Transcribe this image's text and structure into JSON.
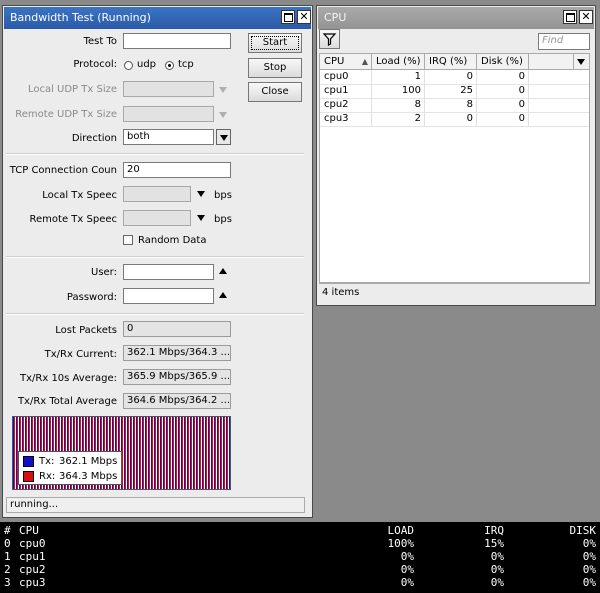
{
  "bandwidth": {
    "title": "Bandwidth Test (Running)",
    "buttons": {
      "start": "Start",
      "stop": "Stop",
      "close": "Close"
    },
    "labels": {
      "test_to": "Test To",
      "protocol": "Protocol:",
      "local_udp": "Local UDP Tx Size",
      "remote_udp": "Remote UDP Tx Size",
      "direction": "Direction",
      "tcp_conn": "TCP Connection Coun",
      "local_tx": "Local Tx Speec",
      "remote_tx": "Remote Tx Speec",
      "user": "User:",
      "password": "Password:",
      "lost": "Lost Packets",
      "current": "Tx/Rx Current:",
      "avg10": "Tx/Rx 10s Average:",
      "total": "Tx/Rx Total Average"
    },
    "protocol_udp": "udp",
    "protocol_tcp": "tcp",
    "direction_value": "both",
    "tcp_conn_value": "20",
    "bps": "bps",
    "random_data": "Random Data",
    "lost_value": "0",
    "current_value": "362.1 Mbps/364.3 ...",
    "avg10_value": "365.9 Mbps/365.9 ...",
    "total_value": "364.6 Mbps/364.2 ...",
    "legend_tx_label": "Tx:",
    "legend_tx_value": "362.1 Mbps",
    "legend_rx_label": "Rx:",
    "legend_rx_value": "364.3 Mbps",
    "tx_color": "#1010c8",
    "rx_color": "#d81010",
    "status": "running..."
  },
  "cpu": {
    "title": "CPU",
    "find_placeholder": "Find",
    "columns": [
      "CPU",
      "Load (%)",
      "IRQ (%)",
      "Disk (%)"
    ],
    "rows": [
      {
        "cpu": "cpu0",
        "load": "1",
        "irq": "0",
        "disk": "0"
      },
      {
        "cpu": "cpu1",
        "load": "100",
        "irq": "25",
        "disk": "0"
      },
      {
        "cpu": "cpu2",
        "load": "8",
        "irq": "8",
        "disk": "0"
      },
      {
        "cpu": "cpu3",
        "load": "2",
        "irq": "0",
        "disk": "0"
      }
    ],
    "count": "4 items"
  },
  "terminal": {
    "header": {
      "num": "#",
      "cpu": "CPU",
      "load": "LOAD",
      "irq": "IRQ",
      "disk": "DISK"
    },
    "rows": [
      {
        "num": "0",
        "cpu": "cpu0",
        "load": "100%",
        "irq": "15%",
        "disk": "0%"
      },
      {
        "num": "1",
        "cpu": "cpu1",
        "load": "0%",
        "irq": "0%",
        "disk": "0%"
      },
      {
        "num": "2",
        "cpu": "cpu2",
        "load": "0%",
        "irq": "0%",
        "disk": "0%"
      },
      {
        "num": "3",
        "cpu": "cpu3",
        "load": "0%",
        "irq": "0%",
        "disk": "0%"
      }
    ]
  }
}
